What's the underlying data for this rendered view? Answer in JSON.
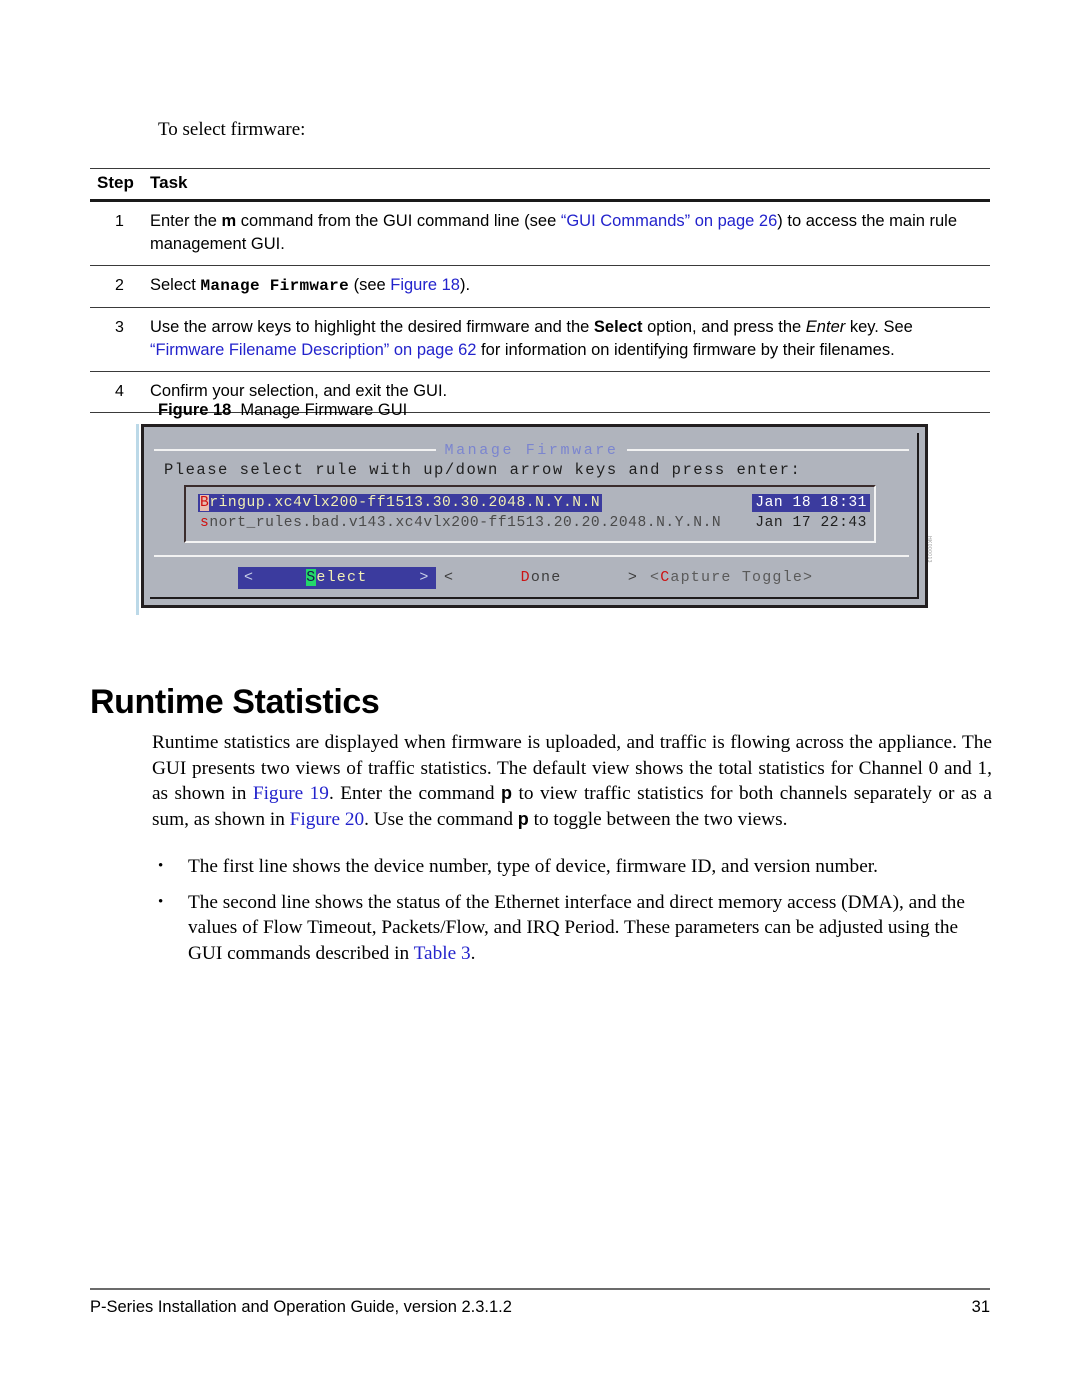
{
  "intro": {
    "text": "To select firmware:"
  },
  "step_table": {
    "headers": {
      "step": "Step",
      "task": "Task"
    },
    "rows": [
      {
        "step": "1",
        "task_parts": [
          {
            "text": "Enter the ",
            "style": "plain"
          },
          {
            "text": "m",
            "style": "bold"
          },
          {
            "text": " command from the GUI command line (see ",
            "style": "plain"
          },
          {
            "text": "“GUI Commands” on page 26",
            "style": "link"
          },
          {
            "text": ") to access the main rule management GUI.",
            "style": "plain"
          }
        ]
      },
      {
        "step": "2",
        "task_parts": [
          {
            "text": "Select ",
            "style": "plain"
          },
          {
            "text": "Manage Firmware",
            "style": "mono-bold"
          },
          {
            "text": " (see ",
            "style": "plain"
          },
          {
            "text": "Figure 18",
            "style": "link"
          },
          {
            "text": ").",
            "style": "plain"
          }
        ]
      },
      {
        "step": "3",
        "task_parts": [
          {
            "text": "Use the arrow keys to highlight the desired firmware and the ",
            "style": "plain"
          },
          {
            "text": "Select",
            "style": "bold"
          },
          {
            "text": " option, and press the ",
            "style": "plain"
          },
          {
            "text": "Enter",
            "style": "italic"
          },
          {
            "text": " key. See ",
            "style": "plain"
          },
          {
            "text": "“Firmware Filename Description” on page 62",
            "style": "link"
          },
          {
            "text": " for information on identifying firmware by their filenames.",
            "style": "plain"
          }
        ]
      },
      {
        "step": "4",
        "task_parts": [
          {
            "text": "Confirm your selection, and exit the GUI.",
            "style": "plain"
          }
        ]
      }
    ]
  },
  "figure": {
    "caption_number": "Figure 18",
    "caption_text": "Manage Firmware GUI",
    "figure_id": "HK000013",
    "terminal": {
      "title": "Manage Firmware",
      "prompt": "Please select rule with up/down arrow keys and press enter:",
      "list": [
        {
          "first_char": "B",
          "filename_rest": "ringup.xc4vlx200-ff1513.30.30.2048.N.Y.N.N",
          "date": "Jan 18 18:31",
          "selected": true
        },
        {
          "first_char": "s",
          "filename_rest": "nort_rules.bad.v143.xc4vlx200-ff1513.20.20.2048.N.Y.N.N",
          "date": "Jan 17 22:43",
          "selected": false
        }
      ],
      "buttons": {
        "select": {
          "left_angle": "<",
          "hotkey": "S",
          "rest": "elect",
          "right_angle": ">",
          "selected": true
        },
        "done": {
          "left_angle": "<",
          "hotkey": "D",
          "rest": "one",
          "right_angle": ">",
          "selected": false
        },
        "capture": {
          "prefix": "<",
          "hotkey": "C",
          "rest": "apture Toggle",
          "suffix": ">",
          "selected": false
        }
      },
      "colors": {
        "background": "#b0b4bd",
        "title": "#7b85cf",
        "selection_bg": "#3b3b9e",
        "selection_fg": "#f2f0b4",
        "hotkey_red": "#cc1414",
        "hotkey_green_bg": "#23d86a"
      }
    }
  },
  "heading": {
    "title": "Runtime Statistics"
  },
  "body": {
    "paragraph_parts": [
      {
        "text": "Runtime statistics are displayed when firmware is uploaded, and traffic is flowing across the appliance. The GUI presents two views of traffic statistics. The default view shows the total statistics for Channel 0 and 1, as shown in ",
        "style": "plain"
      },
      {
        "text": "Figure 19",
        "style": "link"
      },
      {
        "text": ". Enter the command ",
        "style": "plain"
      },
      {
        "text": "p",
        "style": "bold-cmd"
      },
      {
        "text": " to view traffic statistics for both channels separately or as a sum, as shown in ",
        "style": "plain"
      },
      {
        "text": "Figure 20",
        "style": "link"
      },
      {
        "text": ". Use the command ",
        "style": "plain"
      },
      {
        "text": "p",
        "style": "bold-cmd"
      },
      {
        "text": " to toggle between the two views.",
        "style": "plain"
      }
    ],
    "bullets": [
      {
        "parts": [
          {
            "text": "The first line shows the device number, type of device, firmware ID, and version number.",
            "style": "plain"
          }
        ]
      },
      {
        "parts": [
          {
            "text": "The second line shows the status of the Ethernet interface and direct memory access (DMA), and the values of Flow Timeout, Packets/Flow, and IRQ Period. These parameters can be adjusted using the GUI commands described in ",
            "style": "plain"
          },
          {
            "text": "Table 3",
            "style": "link"
          },
          {
            "text": ".",
            "style": "plain"
          }
        ]
      }
    ]
  },
  "footer": {
    "left": "P-Series Installation and Operation Guide, version 2.3.1.2",
    "page_number": "31"
  }
}
